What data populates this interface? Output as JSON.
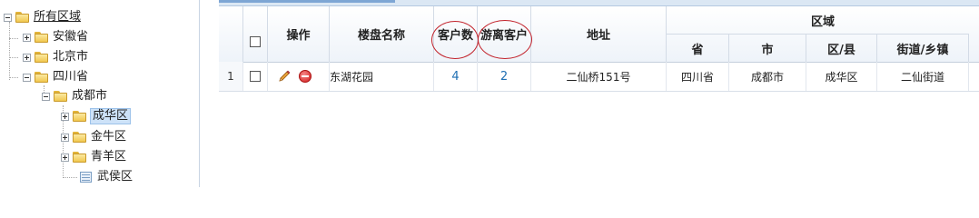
{
  "tree": {
    "root": "所有区域",
    "nodes": [
      {
        "label": "安徽省",
        "expanded": false
      },
      {
        "label": "北京市",
        "expanded": false
      },
      {
        "label": "四川省",
        "expanded": true
      },
      {
        "label": "成都市",
        "expanded": true
      },
      {
        "label": "成华区",
        "expanded": false,
        "selected": true
      },
      {
        "label": "金牛区",
        "expanded": false
      },
      {
        "label": "青羊区",
        "expanded": false
      },
      {
        "label": "武侯区",
        "leaf": true
      }
    ]
  },
  "grid": {
    "headers": {
      "action": "操作",
      "building_name": "楼盘名称",
      "customer_count": "客户数",
      "free_customer": "游离客户",
      "address": "地址",
      "region": "区域",
      "province": "省",
      "city": "市",
      "district": "区/县",
      "street": "街道/乡镇"
    },
    "rows": [
      {
        "index": "1",
        "building_name": "东湖花园",
        "customer_count": "4",
        "free_customer": "2",
        "address": "二仙桥151号",
        "province": "四川省",
        "city": "成都市",
        "district": "成华区",
        "street": "二仙街道"
      }
    ]
  },
  "colors": {
    "accent": "#1f6fb3",
    "annotation": "#c2222b",
    "header_border": "#c4cfdc"
  },
  "icons": [
    "folder-icon",
    "expand-toggle-icon",
    "collapse-toggle-icon",
    "document-icon",
    "checkbox-icon",
    "pencil-icon",
    "delete-icon"
  ]
}
